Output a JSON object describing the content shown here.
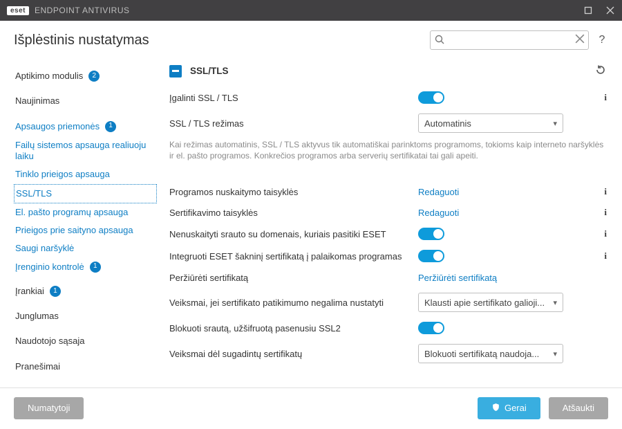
{
  "titlebar": {
    "brand_left": "eset",
    "brand_right": "ENDPOINT ANTIVIRUS"
  },
  "header": {
    "title": "Išplėstinis nustatymas",
    "search_placeholder": ""
  },
  "sidebar": {
    "items": [
      {
        "label": "Aptikimo modulis",
        "badge": "2"
      },
      {
        "label": "Naujinimas",
        "badge": null
      },
      {
        "label": "Apsaugos priemonės",
        "badge": "1"
      },
      {
        "label": "Failų sistemos apsauga realiuoju laiku",
        "sub": true
      },
      {
        "label": "Tinklo prieigos apsauga",
        "sub": true
      },
      {
        "label": "SSL/TLS",
        "sub": true,
        "selected": true
      },
      {
        "label": "El. pašto programų apsauga",
        "sub": true
      },
      {
        "label": "Prieigos prie saityno apsauga",
        "sub": true
      },
      {
        "label": "Saugi naršyklė",
        "sub": true
      },
      {
        "label": "Įrenginio kontrolė",
        "badge": "1",
        "sub": true
      },
      {
        "label": "Įrankiai",
        "badge": "1"
      },
      {
        "label": "Junglumas",
        "badge": null
      },
      {
        "label": "Naudotojo sąsaja",
        "badge": null
      },
      {
        "label": "Pranešimai",
        "badge": null
      }
    ]
  },
  "main": {
    "section_title": "SSL/TLS",
    "rows": {
      "enable_label": "Įgalinti SSL / TLS",
      "mode_label": "SSL / TLS režimas",
      "mode_value": "Automatinis",
      "mode_note": "Kai režimas automatinis, SSL / TLS aktyvus tik automatiškai parinktoms programoms, tokioms kaip interneto naršyklės ir el. pašto programos. Konkrečios programos arba serverių sertifikatai tai gali apeiti.",
      "app_rules_label": "Programos nuskaitymo taisyklės",
      "app_rules_action": "Redaguoti",
      "cert_rules_label": "Sertifikavimo taisyklės",
      "cert_rules_action": "Redaguoti",
      "trusted_domains_label": "Nenuskaityti srauto su domenais, kuriais pasitiki ESET",
      "integrate_root_label": "Integruoti ESET šakninį sertifikatą į palaikomas programas",
      "view_cert_label": "Peržiūrėti sertifikatą",
      "view_cert_action": "Peržiūrėti sertifikatą",
      "unknown_validity_label": "Veiksmai, jei sertifikato patikimumo negalima nustatyti",
      "unknown_validity_value": "Klausti apie sertifikato galioji...",
      "block_ssl2_label": "Blokuoti srautą, užšifruotą pasenusiu SSL2",
      "damaged_cert_label": "Veiksmai dėl sugadintų sertifikatų",
      "damaged_cert_value": "Blokuoti sertifikatą naudoja..."
    }
  },
  "footer": {
    "default": "Numatytoji",
    "ok": "Gerai",
    "cancel": "Atšaukti"
  }
}
